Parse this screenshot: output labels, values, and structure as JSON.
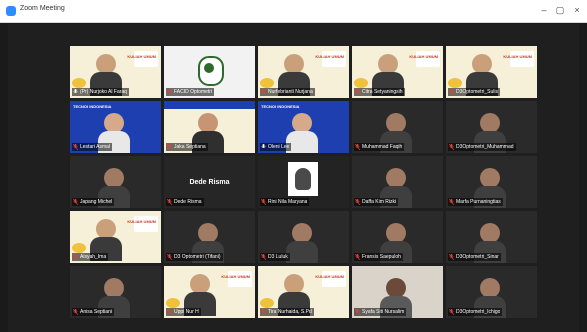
{
  "window": {
    "title": "Zoom Meeting"
  },
  "colors": {
    "active_speaker_border": "#c8f24d",
    "mic_muted": "#e0413b",
    "banner_blue": "#1e3fb0",
    "banner_cream": "#f6f0d8"
  },
  "participants": [
    {
      "name": "(Pr) Nurjoko Al Faraq",
      "muted": false,
      "scene": "cream",
      "active": true
    },
    {
      "name": "FACID Optometri",
      "muted": true,
      "scene": "logo"
    },
    {
      "name": "Nurfebrianti Nurjana",
      "muted": true,
      "scene": "cream"
    },
    {
      "name": "Citra Setyaningsih",
      "muted": true,
      "scene": "cream"
    },
    {
      "name": "D3Optometri_Sulis",
      "muted": true,
      "scene": "cream"
    },
    {
      "name": "Lestari Asmal",
      "muted": true,
      "scene": "blue"
    },
    {
      "name": "Jaka Septiana",
      "muted": true,
      "scene": "blue-cream"
    },
    {
      "name": "Oleni Lee",
      "muted": false,
      "scene": "blue"
    },
    {
      "name": "Muhammad Faqih",
      "muted": true,
      "scene": "dark"
    },
    {
      "name": "D3Optometri_Muhammad",
      "muted": true,
      "scene": "dark"
    },
    {
      "name": "Japang Michel",
      "muted": true,
      "scene": "dark"
    },
    {
      "name": "Dede Risma",
      "muted": true,
      "scene": "text"
    },
    {
      "name": "Rini Nila Maryana",
      "muted": true,
      "scene": "drawing"
    },
    {
      "name": "Daffa Kim Rizki",
      "muted": true,
      "scene": "dark"
    },
    {
      "name": "Marfa Purnaningtias",
      "muted": true,
      "scene": "dark"
    },
    {
      "name": "Aisyah_Ima",
      "muted": true,
      "scene": "cream"
    },
    {
      "name": "D3 Optometri (Tifani)",
      "muted": true,
      "scene": "dark"
    },
    {
      "name": "D3 Luluk",
      "muted": true,
      "scene": "dark"
    },
    {
      "name": "Fransis Saepuloh",
      "muted": true,
      "scene": "dark"
    },
    {
      "name": "D3Optometri_Sinar",
      "muted": true,
      "scene": "dark"
    },
    {
      "name": "Anisa Septiani",
      "muted": true,
      "scene": "dark"
    },
    {
      "name": "Uppi Nur H",
      "muted": true,
      "scene": "cream"
    },
    {
      "name": "Tira Nurhaida, S.Pd",
      "muted": true,
      "scene": "cream"
    },
    {
      "name": "Syafa Siti Nursalim",
      "muted": true,
      "scene": "wall"
    },
    {
      "name": "D3Optometri_Ichigo",
      "muted": true,
      "scene": "dark"
    }
  ],
  "banner_texts": {
    "kuliah_umum": "KULIAH UMUM",
    "institution": "TECNOI INDONESIA"
  },
  "center_name_tile": {
    "text": "Dede Risma"
  }
}
